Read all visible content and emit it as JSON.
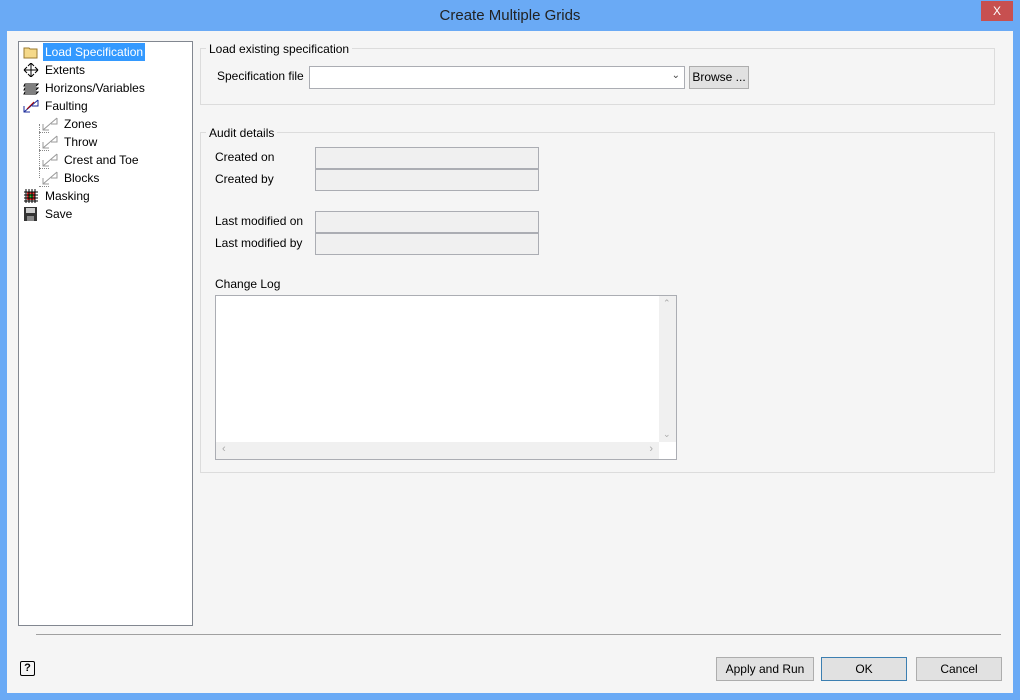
{
  "window": {
    "title": "Create Multiple Grids",
    "close_label": "X"
  },
  "tree": {
    "items": [
      {
        "label": "Load Specification",
        "icon": "folder-icon"
      },
      {
        "label": "Extents",
        "icon": "move-arrows-icon"
      },
      {
        "label": "Horizons/Variables",
        "icon": "layers-icon"
      },
      {
        "label": "Faulting",
        "icon": "fault-icon"
      },
      {
        "label": "Zones",
        "icon": "fault-sub-icon"
      },
      {
        "label": "Throw",
        "icon": "fault-sub-icon"
      },
      {
        "label": "Crest and Toe",
        "icon": "fault-sub-icon"
      },
      {
        "label": "Blocks",
        "icon": "fault-sub-icon"
      },
      {
        "label": "Masking",
        "icon": "grid-mask-icon"
      },
      {
        "label": "Save",
        "icon": "floppy-disk-icon"
      }
    ]
  },
  "load": {
    "title": "Load existing specification",
    "spec_label": "Specification file",
    "spec_value": "",
    "browse": "Browse ..."
  },
  "audit": {
    "title": "Audit details",
    "created_on": "Created on",
    "created_by": "Created by",
    "modified_on": "Last modified on",
    "modified_by": "Last modified by",
    "change_log": "Change Log"
  },
  "footer": {
    "apply": "Apply and Run",
    "ok": "OK",
    "cancel": "Cancel",
    "help_icon": "help-icon"
  }
}
